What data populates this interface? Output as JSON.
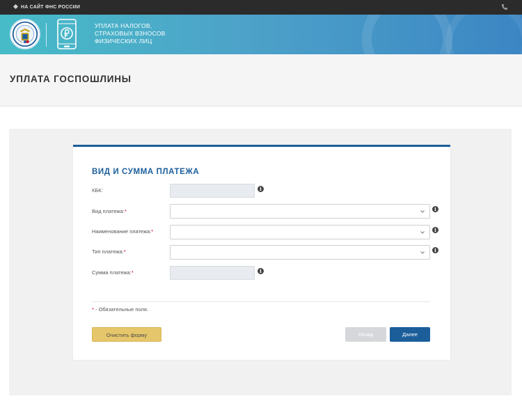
{
  "topbar": {
    "back_link": "НА САЙТ ФНС РОССИИ",
    "icons": [
      "diamond-icon",
      "phone-icon"
    ]
  },
  "banner": {
    "title_lines": [
      "УПЛАТА НАЛОГОВ,",
      "СТРАХОВЫХ ВЗНОСОВ",
      "ФИЗИЧЕСКИХ ЛИЦ"
    ],
    "icons": [
      "fns-emblem-icon",
      "phone-ruble-logo-icon"
    ]
  },
  "page": {
    "title": "УПЛАТА ГОСПОШЛИНЫ"
  },
  "form": {
    "section_title": "ВИД И СУММА ПЛАТЕЖА",
    "kbk": {
      "label": "КБК:",
      "value": ""
    },
    "payment_kind": {
      "label": "Вид платежа:",
      "required_mark": "*",
      "value": ""
    },
    "payment_name": {
      "label": "Наименование платежа:",
      "required_mark": "*",
      "value": ""
    },
    "payment_type": {
      "label": "Тип платежа:",
      "required_mark": "*",
      "value": ""
    },
    "amount": {
      "label": "Сумма платежа:",
      "required_mark": "*",
      "value": ""
    },
    "info_glyph": "i",
    "note": {
      "mark": "*",
      "text": " - Обязательные поля."
    }
  },
  "buttons": {
    "clear": "Очистить форму",
    "back": "Назад",
    "next": "Далее"
  },
  "colors": {
    "topbar": "#2b2b2b",
    "banner_start": "#47bcc8",
    "banner_end": "#3c86c4",
    "accent": "#1b5e9a",
    "clear_button": "#e6c66a",
    "back_button_disabled": "#d5d7da",
    "required": "#d0021b"
  }
}
